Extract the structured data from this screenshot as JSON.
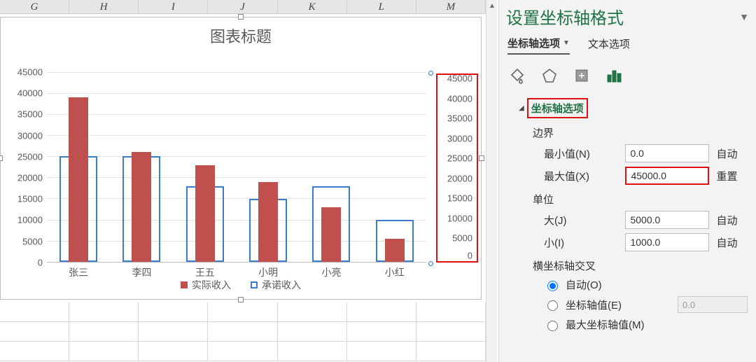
{
  "columns": [
    "G",
    "H",
    "I",
    "J",
    "K",
    "L",
    "M"
  ],
  "chart_title": "图表标题",
  "chart_data": {
    "type": "bar",
    "categories": [
      "张三",
      "李四",
      "王五",
      "小明",
      "小亮",
      "小红"
    ],
    "series": [
      {
        "name": "实际收入",
        "values": [
          39000,
          26000,
          23000,
          19000,
          13000,
          5500
        ]
      },
      {
        "name": "承诺收入",
        "values": [
          25000,
          25000,
          18000,
          15000,
          18000,
          10000
        ]
      }
    ],
    "ylim": [
      0,
      45000
    ],
    "ystep": 5000,
    "secondary_ylim": [
      0,
      45000
    ],
    "secondary_ystep": 5000,
    "title": "图表标题",
    "xlabel": "",
    "ylabel": ""
  },
  "y_ticks": [
    "45000",
    "40000",
    "35000",
    "30000",
    "25000",
    "20000",
    "15000",
    "10000",
    "5000",
    "0"
  ],
  "sec_ticks": [
    "45000",
    "40000",
    "35000",
    "30000",
    "25000",
    "20000",
    "15000",
    "10000",
    "5000",
    "0"
  ],
  "legend": {
    "s1": "实际收入",
    "s2": "承诺收入"
  },
  "panel": {
    "title": "设置坐标轴格式",
    "tab_axis": "坐标轴选项",
    "tab_text": "文本选项",
    "section_axis_options": "坐标轴选项",
    "bounds": "边界",
    "min_label": "最小值(N)",
    "min_value": "0.0",
    "min_suffix": "自动",
    "max_label": "最大值(X)",
    "max_value": "45000.0",
    "max_suffix": "重置",
    "unit": "单位",
    "major_label": "大(J)",
    "major_value": "5000.0",
    "major_suffix": "自动",
    "minor_label": "小(I)",
    "minor_value": "1000.0",
    "minor_suffix": "自动",
    "cross": "横坐标轴交叉",
    "cross_auto": "自动(O)",
    "cross_val": "坐标轴值(E)",
    "cross_val_value": "0.0",
    "cross_max": "最大坐标轴值(M)"
  }
}
